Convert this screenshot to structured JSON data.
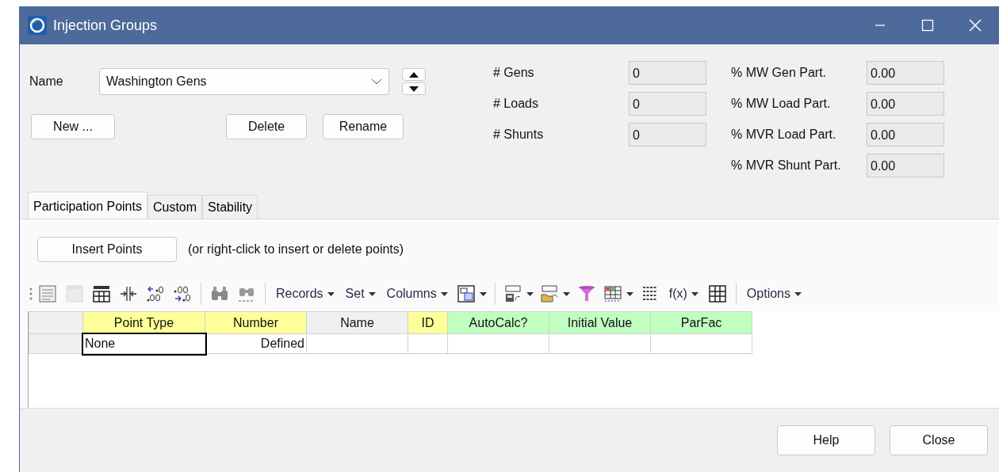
{
  "window": {
    "title": "Injection Groups"
  },
  "name_field": {
    "label": "Name",
    "value": "Washington Gens"
  },
  "group_buttons": [
    "New ...",
    "Delete",
    "Rename"
  ],
  "counts": [
    {
      "label": "# Gens",
      "value": "0"
    },
    {
      "label": "# Loads",
      "value": "0"
    },
    {
      "label": "# Shunts",
      "value": "0"
    }
  ],
  "participation": [
    {
      "label": "% MW Gen Part.",
      "value": "0.00"
    },
    {
      "label": "% MW Load Part.",
      "value": "0.00"
    },
    {
      "label": "% MVR Load Part.",
      "value": "0.00"
    },
    {
      "label": "% MVR Shunt Part.",
      "value": "0.00"
    }
  ],
  "tabs": [
    {
      "label": "Participation Points",
      "selected": true
    },
    {
      "label": "Custom",
      "selected": false
    },
    {
      "label": "Stability",
      "selected": false
    }
  ],
  "insert_button": "Insert Points",
  "insert_hint": "(or right-click to insert or delete points)",
  "toolbar": [
    {
      "kind": "grip"
    },
    {
      "kind": "icon",
      "disabled": false
    },
    {
      "kind": "icon",
      "disabled": true
    },
    {
      "kind": "icon",
      "disabled": false
    },
    {
      "kind": "icon",
      "disabled": false
    },
    {
      "kind": "icon",
      "disabled": false
    },
    {
      "kind": "icon",
      "disabled": false
    },
    {
      "kind": "sep"
    },
    {
      "kind": "icon",
      "disabled": false
    },
    {
      "kind": "icon",
      "disabled": false
    },
    {
      "kind": "sep"
    },
    {
      "kind": "menu",
      "label": "Records"
    },
    {
      "kind": "menu",
      "label": "Set"
    },
    {
      "kind": "menu",
      "label": "Columns"
    },
    {
      "kind": "icondrop"
    },
    {
      "kind": "sep"
    },
    {
      "kind": "icondrop"
    },
    {
      "kind": "icondrop"
    },
    {
      "kind": "icon",
      "disabled": false
    },
    {
      "kind": "icondrop"
    },
    {
      "kind": "icon",
      "disabled": false
    },
    {
      "kind": "menu",
      "label": "f(x)"
    },
    {
      "kind": "icon",
      "disabled": false
    },
    {
      "kind": "sep"
    },
    {
      "kind": "menu",
      "label": "Options"
    }
  ],
  "table": {
    "columns": [
      {
        "label": "Point Type",
        "color": "#ffff99"
      },
      {
        "label": "Number",
        "color": "#ffff99"
      },
      {
        "label": "Name",
        "color": "#f0f0f0"
      },
      {
        "label": "ID",
        "color": "#ffff99"
      },
      {
        "label": "AutoCalc?",
        "color": "#c0ffc0"
      },
      {
        "label": "Initial Value",
        "color": "#c0ffc0"
      },
      {
        "label": "ParFac",
        "color": "#c0ffc0"
      }
    ],
    "rows": [
      [
        "None",
        "Defined",
        "",
        "",
        "",
        "",
        ""
      ]
    ]
  },
  "footer_buttons": [
    "Help",
    "Close"
  ]
}
